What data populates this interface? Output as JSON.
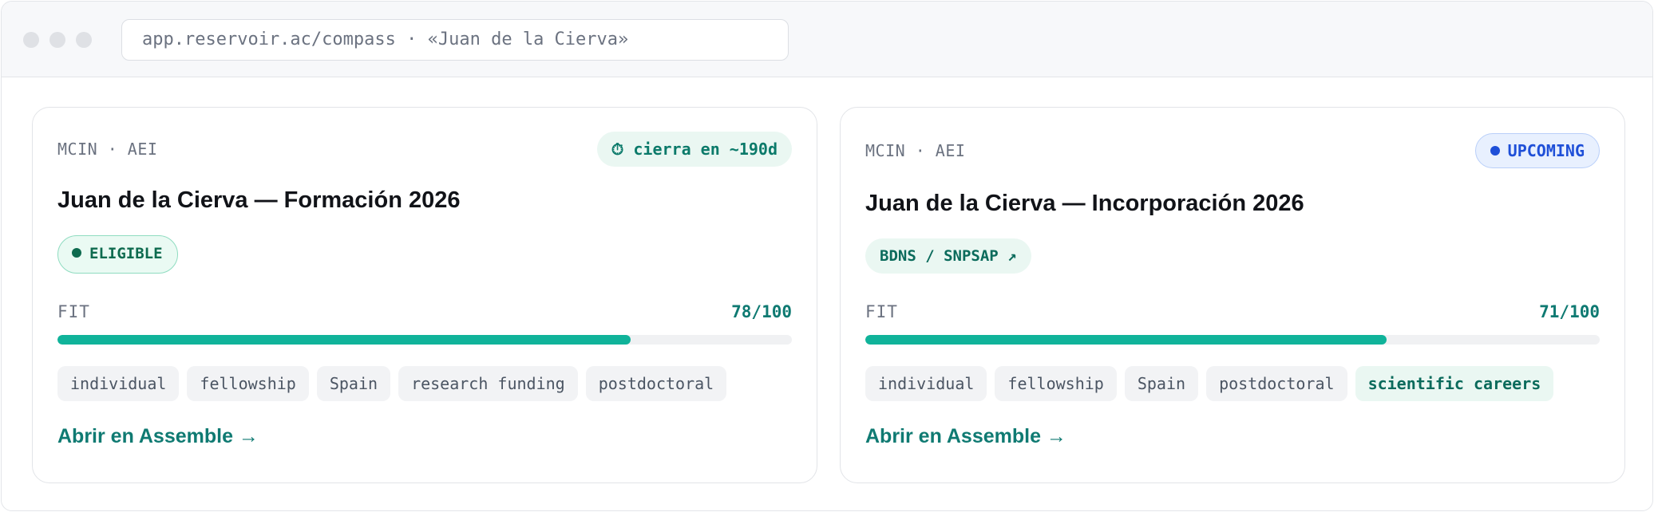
{
  "browser": {
    "url": "app.reservoir.ac/compass · «Juan de la Cierva»"
  },
  "cards": [
    {
      "agency": "MCIN · AEI",
      "title": "Juan de la Cierva — Formación 2026",
      "top_pill": {
        "icon": "clock-icon",
        "icon_glyph": "⏱",
        "label": "cierra en ~190d"
      },
      "status": {
        "label": "ELIGIBLE",
        "color": "#0e6b4f"
      },
      "fit_label": "FIT",
      "fit_value": 78,
      "fit_max": 100,
      "fit_text": "78/100",
      "tags": [
        "individual",
        "fellowship",
        "Spain",
        "research funding",
        "postdoctoral"
      ],
      "cta": "Abrir en Assemble →"
    },
    {
      "agency": "MCIN · AEI",
      "title": "Juan de la Cierva — Incorporación 2026",
      "top_pill": {
        "label": "UPCOMING",
        "color": "#1e4fd8"
      },
      "link": {
        "label": "BDNS / SNPSAP ↗"
      },
      "fit_label": "FIT",
      "fit_value": 71,
      "fit_max": 100,
      "fit_text": "71/100",
      "tags": [
        "individual",
        "fellowship",
        "Spain",
        "postdoctoral"
      ],
      "highlight_tag": "scientific careers",
      "cta": "Abrir en Assemble →"
    }
  ],
  "colors": {
    "accent": "#0f7a72",
    "progress": "#10b39a",
    "eligible_dot": "#0e6b4f",
    "upcoming_dot": "#1e4fd8"
  }
}
